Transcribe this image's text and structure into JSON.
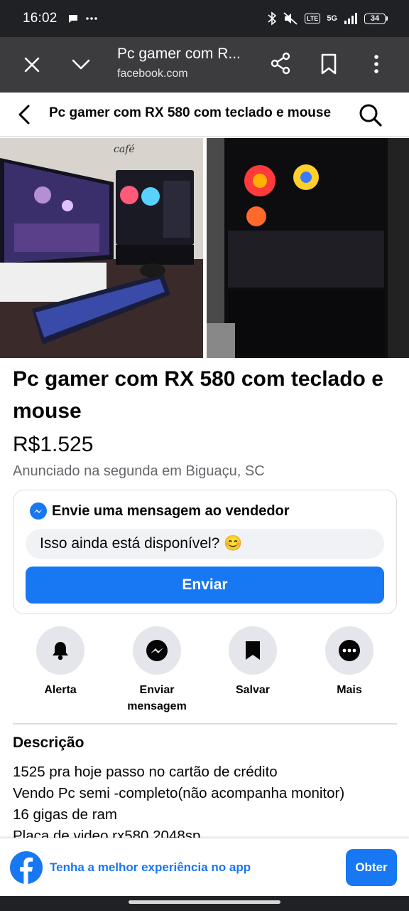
{
  "status_bar": {
    "time": "16:02",
    "battery": "34",
    "network_badge": "5G"
  },
  "browser": {
    "tab_title": "Pc gamer com R...",
    "url": "facebook.com"
  },
  "header": {
    "title": "Pc gamer com RX 580 com teclado e mouse"
  },
  "listing": {
    "title": "Pc gamer com RX 580 com teclado e mouse",
    "price": "R$1.525",
    "meta": "Anunciado na segunda em Biguaçu, SC"
  },
  "message_card": {
    "title": "Envie uma mensagem ao vendedor",
    "input_value": "Isso ainda está disponível? 😊",
    "send_label": "Enviar"
  },
  "actions": [
    {
      "label": "Alerta",
      "icon": "bell-icon"
    },
    {
      "label": "Enviar mensagem",
      "icon": "messenger-icon"
    },
    {
      "label": "Salvar",
      "icon": "bookmark-icon"
    },
    {
      "label": "Mais",
      "icon": "more-icon"
    }
  ],
  "description": {
    "heading": "Descrição",
    "lines": [
      "1525 pra hoje passo no cartão de crédito",
      "Vendo Pc semi -completo(não acompanha monitor)",
      "16 gigas de ram",
      "Placa de video rx580 2048sp"
    ]
  },
  "app_banner": {
    "text": "Tenha a melhor experiência no app",
    "button_label": "Obter"
  },
  "colors": {
    "facebook_blue": "#1877f2",
    "browser_bar": "#3c3c3f",
    "status_bar": "#202124",
    "secondary_text": "#65676b",
    "action_circle": "#e4e6eb"
  }
}
